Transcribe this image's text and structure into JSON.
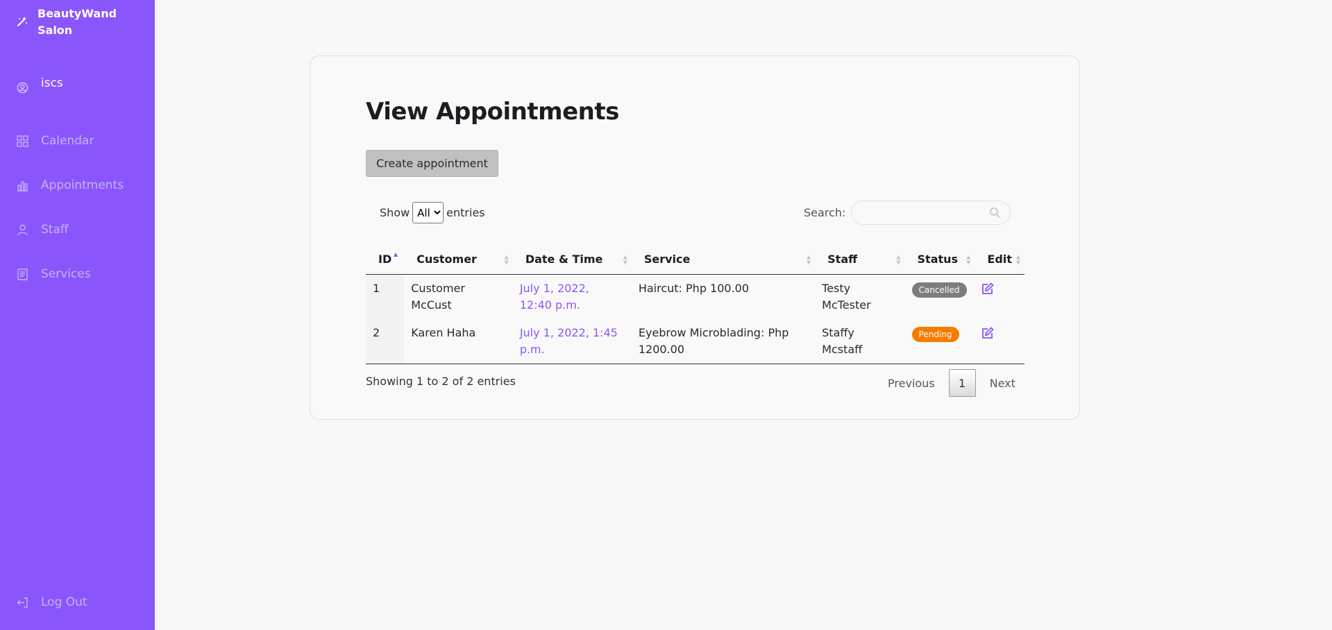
{
  "sidebar": {
    "brand": "BeautyWand Salon",
    "user": "iscs",
    "items": [
      {
        "label": "Calendar"
      },
      {
        "label": "Appointments"
      },
      {
        "label": "Staff"
      },
      {
        "label": "Services"
      }
    ],
    "logout": "Log Out"
  },
  "main": {
    "title": "View Appointments",
    "create_button": "Create appointment",
    "show_label": "Show",
    "entries_label": "entries",
    "entries_value": "All",
    "search_label": "Search:",
    "search_value": "",
    "columns": [
      "ID",
      "Customer",
      "Date & Time",
      "Service",
      "Staff",
      "Status",
      "Edit"
    ],
    "rows": [
      {
        "id": "1",
        "customer": "Customer McCust",
        "datetime": "July 1, 2022, 12:40 p.m.",
        "service": "Haircut: Php 100.00",
        "staff": "Testy McTester",
        "status": "Cancelled",
        "status_color": "#7d7d7d"
      },
      {
        "id": "2",
        "customer": "Karen Haha",
        "datetime": "July 1, 2022, 1:45 p.m.",
        "service": "Eyebrow Microblading: Php 1200.00",
        "staff": "Staffy Mcstaff",
        "status": "Pending",
        "status_color": "#f57c00"
      }
    ],
    "info": "Showing 1 to 2 of 2 entries",
    "pagination": {
      "previous": "Previous",
      "page": "1",
      "next": "Next"
    }
  },
  "colors": {
    "accent": "#8a56fb",
    "sidebar_bg": "#8a56fb",
    "nav_text": "#c6b2ff"
  },
  "icons": {
    "brand": "magic-wand-icon",
    "user": "user-circle-icon",
    "calendar": "grid-icon",
    "appointments": "bar-chart-icon",
    "staff": "person-icon",
    "services": "book-icon",
    "logout": "logout-icon",
    "search": "search-icon",
    "edit": "edit-icon"
  }
}
